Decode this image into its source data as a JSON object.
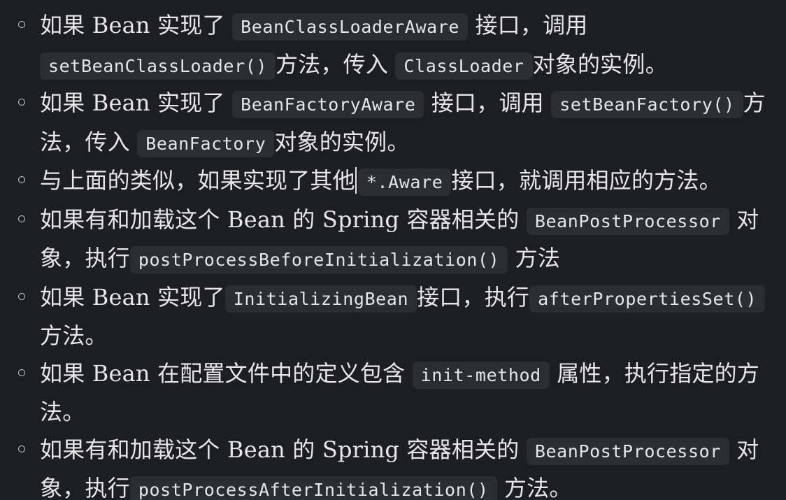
{
  "items": [
    {
      "a": "如果 Bean 实现了 ",
      "c1": "BeanClassLoaderAware",
      "b": " 接口，调用 ",
      "c2": "setBeanClassLoader()",
      "d": "方法，传入 ",
      "c3": "ClassLoader",
      "e": "对象的实例。"
    },
    {
      "a": "如果 Bean 实现了 ",
      "c1": "BeanFactoryAware",
      "b": " 接口，调用 ",
      "c2": "setBeanFactory()",
      "d": "方法，传入 ",
      "c3": "BeanFactory",
      "e": "对象的实例。"
    },
    {
      "a": "与上面的类似，如果实现了其他",
      "c1": "*.Aware",
      "b": "接口，就调用相应的方法。"
    },
    {
      "a": "如果有和加载这个 Bean 的 Spring 容器相关的 ",
      "c1": "BeanPostProcessor",
      "b": " 对象，执行",
      "c2": "postProcessBeforeInitialization()",
      "d": " 方法"
    },
    {
      "a": "如果 Bean 实现了",
      "c1": "InitializingBean",
      "b": "接口，执行",
      "c2": "afterPropertiesSet()",
      "d": "方法。"
    },
    {
      "a": "如果 Bean 在配置文件中的定义包含 ",
      "c1": "init-method",
      "b": " 属性，执行指定的方法。"
    },
    {
      "a": "如果有和加载这个 Bean 的 Spring 容器相关的 ",
      "c1": "BeanPostProcessor",
      "b": " 对象，执行",
      "c2": "postProcessAfterInitialization()",
      "d": " 方法。"
    }
  ]
}
